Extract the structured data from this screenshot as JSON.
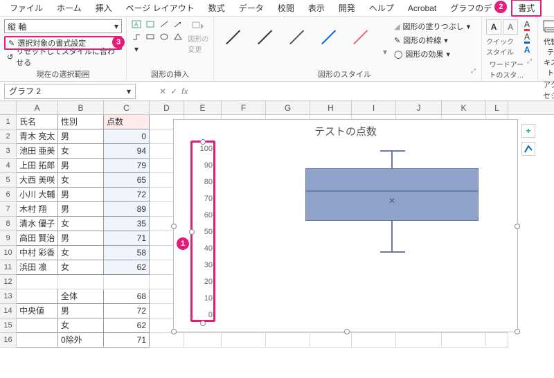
{
  "menu": [
    "ファイル",
    "ホーム",
    "挿入",
    "ページ レイアウト",
    "数式",
    "データ",
    "校閲",
    "表示",
    "開発",
    "ヘルプ",
    "Acrobat",
    "グラフのデ",
    "書式"
  ],
  "ribbon": {
    "selection": {
      "combo": "縦 軸",
      "format_sel": "選択対象の書式設定",
      "reset": "リセットしてスタイルに合わせる",
      "group_label": "現在の選択範囲"
    },
    "shape_insert": {
      "change": "図形の\n変更",
      "group_label": "図形の挿入"
    },
    "shape_style": {
      "fill": "図形の塗りつぶし",
      "outline": "図形の枠線",
      "effects": "図形の効果",
      "group_label": "図形のスタイル"
    },
    "quick_style": "クイック\nスタイル",
    "wordart": {
      "group_label": "ワードアートのスタ…"
    },
    "accessibility": {
      "label": "代替テ\nキスト",
      "group_label": "アクセシビ…"
    }
  },
  "namebox": "グラフ 2",
  "columns": [
    "A",
    "B",
    "C",
    "D",
    "E",
    "F",
    "G",
    "H",
    "I",
    "J",
    "K",
    "L"
  ],
  "rows16": [
    "1",
    "2",
    "3",
    "4",
    "5",
    "6",
    "7",
    "8",
    "9",
    "10",
    "11",
    "12",
    "13",
    "14",
    "15",
    "16"
  ],
  "table": {
    "headers": [
      "氏名",
      "性別",
      "点数"
    ],
    "data": [
      [
        "青木 亮太",
        "男",
        "0"
      ],
      [
        "池田 亜美",
        "女",
        "94"
      ],
      [
        "上田 拓郎",
        "男",
        "79"
      ],
      [
        "大西 美咲",
        "女",
        "65"
      ],
      [
        "小川 大輔",
        "男",
        "72"
      ],
      [
        "木村 翔",
        "男",
        "89"
      ],
      [
        "清水 優子",
        "女",
        "35"
      ],
      [
        "高田 賢治",
        "男",
        "71"
      ],
      [
        "中村 彩香",
        "女",
        "58"
      ],
      [
        "浜田 凛",
        "女",
        "62"
      ]
    ],
    "summary_header": "中央値",
    "summary": [
      [
        "全体",
        "68"
      ],
      [
        "男",
        "72"
      ],
      [
        "女",
        "62"
      ],
      [
        "0除外",
        "71"
      ]
    ]
  },
  "chart_data": {
    "type": "boxplot",
    "title": "テストの点数",
    "ylabel": "",
    "ylim": [
      0,
      100
    ],
    "yticks": [
      "100",
      "90",
      "80",
      "70",
      "60",
      "50",
      "40",
      "30",
      "20",
      "10",
      "0"
    ],
    "series": [
      {
        "name": "点数",
        "min": 35,
        "q1": 60,
        "median": 70,
        "mean": 63,
        "q3": 81,
        "max": 94
      }
    ]
  },
  "badges": {
    "axis": "1",
    "tab": "2",
    "format_sel": "3"
  }
}
